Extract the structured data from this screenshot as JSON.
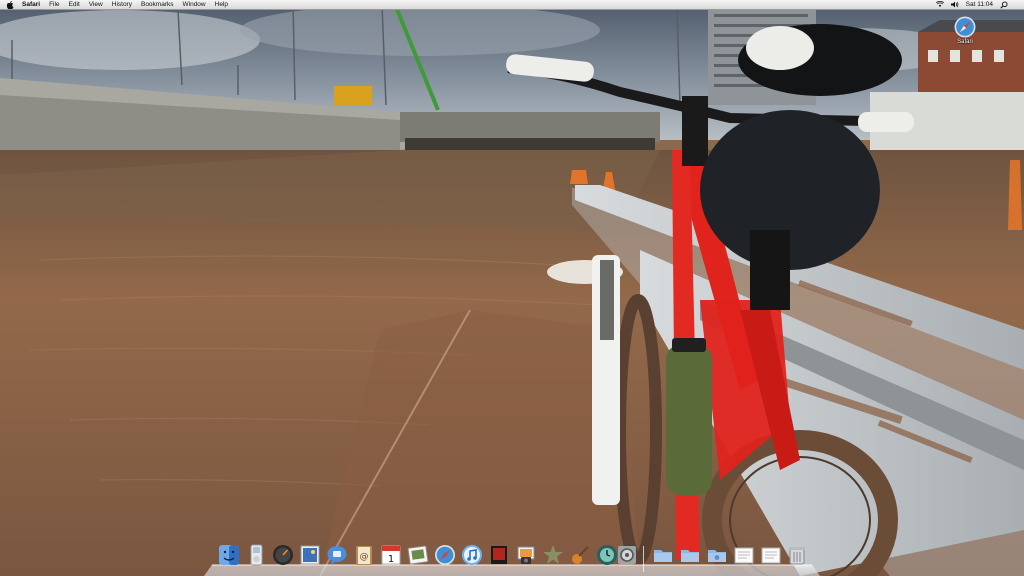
{
  "menubar": {
    "apple_icon": "apple-icon",
    "app_name": "Safari",
    "menus": [
      "File",
      "Edit",
      "View",
      "History",
      "Bookmarks",
      "Window",
      "Help"
    ],
    "clock": "Sat 11:04",
    "status_icons": [
      "wifi-icon",
      "volume-icon"
    ],
    "spotlight_icon": "spotlight-icon"
  },
  "desktop": {
    "icons": [
      {
        "label": "Safari",
        "icon": "safari-compass-icon"
      }
    ]
  },
  "dock": {
    "apps": [
      {
        "name": "finder",
        "icon": "finder-icon"
      },
      {
        "name": "ipod-widget",
        "icon": "ipod-icon"
      },
      {
        "name": "dashboard",
        "icon": "dashboard-icon"
      },
      {
        "name": "preview",
        "icon": "preview-icon"
      },
      {
        "name": "ichat",
        "icon": "ichat-icon"
      },
      {
        "name": "address-book",
        "icon": "address-book-icon"
      },
      {
        "name": "ical",
        "icon": "calendar-icon",
        "badge": "1"
      },
      {
        "name": "photo-booth",
        "icon": "photo-booth-icon"
      },
      {
        "name": "safari",
        "icon": "safari-compass-icon"
      },
      {
        "name": "itunes",
        "icon": "itunes-icon"
      },
      {
        "name": "front-row",
        "icon": "front-row-icon"
      },
      {
        "name": "iphoto",
        "icon": "iphoto-icon"
      },
      {
        "name": "imovie",
        "icon": "imovie-icon"
      },
      {
        "name": "garageband",
        "icon": "garageband-icon"
      },
      {
        "name": "time-machine",
        "icon": "time-machine-icon"
      },
      {
        "name": "system-preferences",
        "icon": "system-preferences-icon"
      }
    ],
    "stacks": [
      {
        "name": "applications-folder",
        "icon": "folder-icon"
      },
      {
        "name": "documents-folder",
        "icon": "folder-icon"
      },
      {
        "name": "downloads-folder",
        "icon": "folder-icon"
      },
      {
        "name": "document-stack",
        "icon": "document-icon"
      },
      {
        "name": "document-stack-2",
        "icon": "document-icon"
      },
      {
        "name": "trash",
        "icon": "trash-icon"
      }
    ]
  },
  "colors": {
    "sky": "#6f7c8c",
    "water": "#8c6448",
    "bike_frame": "#e0231c",
    "wall": "#c9cbc6"
  }
}
